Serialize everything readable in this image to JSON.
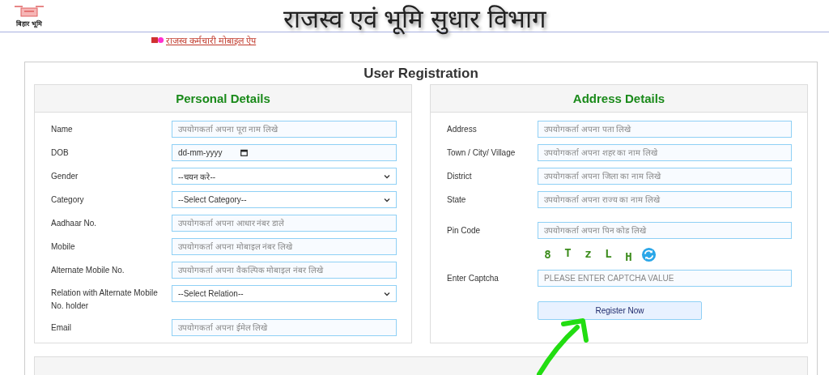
{
  "header": {
    "logo_text": "बिहार भूमि",
    "title": "राजस्व एवं भूमि सुधार विभाग",
    "link": "राजस्व कर्मचारी मोबाइल ऐप"
  },
  "form": {
    "title": "User Registration",
    "panels": [
      {
        "title": "Personal Details",
        "fields": [
          {
            "kind": "text",
            "label": "Name",
            "placeholder": "उपयोगकर्ता अपना पूरा नाम लिखे"
          },
          {
            "kind": "date",
            "label": "DOB",
            "placeholder": "dd-mm-yyyy"
          },
          {
            "kind": "select",
            "label": "Gender",
            "value": "--चयन करे--"
          },
          {
            "kind": "select",
            "label": "Category",
            "value": "--Select Category--"
          },
          {
            "kind": "text",
            "label": "Aadhaar No.",
            "placeholder": "उपयोगकर्ता अपना आधार नंबर डाले"
          },
          {
            "kind": "text",
            "label": "Mobile",
            "placeholder": "उपयोगकर्ता अपना मोबाइल नंबर लिखे"
          },
          {
            "kind": "text",
            "label": "Alternate Mobile No.",
            "placeholder": "उपयोगकर्ता अपना वैकल्पिक मोबाइल नंबर लिखे"
          },
          {
            "kind": "select",
            "label": "Relation with Alternate Mobile No. holder",
            "value": "--Select Relation--"
          },
          {
            "kind": "text",
            "label": "Email",
            "placeholder": "उपयोगकर्ता अपना ईमेल लिखे"
          }
        ]
      },
      {
        "title": "Address Details",
        "fields": [
          {
            "kind": "text",
            "label": "Address",
            "placeholder": "उपयोगकर्ता अपना पता लिखे"
          },
          {
            "kind": "text",
            "label": "Town / City/ Village",
            "placeholder": "उपयोगकर्ता अपना शहर का नाम लिखे"
          },
          {
            "kind": "text",
            "label": "District",
            "placeholder": "उपयोगकर्ता अपना जिला का नाम लिखे"
          },
          {
            "kind": "text",
            "label": "State",
            "placeholder": "उपयोगकर्ता अपना राज्य का नाम लिखे"
          },
          {
            "kind": "text",
            "label": "Pin Code",
            "placeholder": "उपयोगकर्ता अपना पिन कोड लिखे"
          },
          {
            "kind": "captcha",
            "characters": [
              "8",
              "T",
              "z",
              "L",
              "H"
            ]
          },
          {
            "kind": "text",
            "label": "Enter Captcha",
            "placeholder": "PLEASE ENTER CAPTCHA VALUE"
          },
          {
            "kind": "button",
            "label": "Register Now"
          }
        ]
      }
    ]
  }
}
